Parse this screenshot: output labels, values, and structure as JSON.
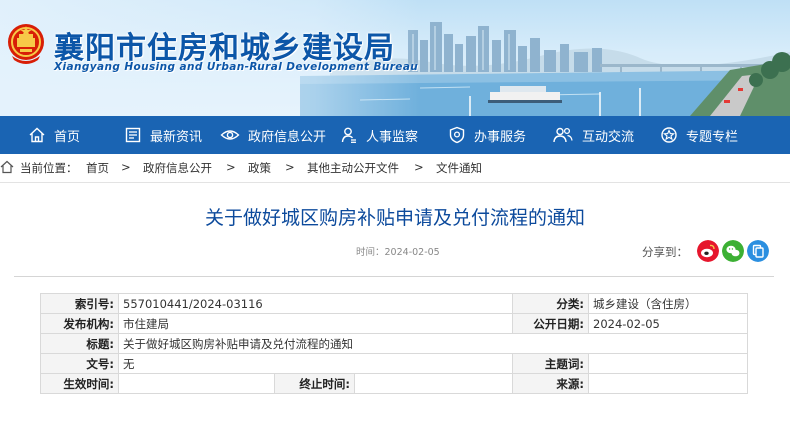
{
  "site": {
    "title": "襄阳市住房和城乡建设局",
    "subtitle": "Xiangyang Housing and Urban-Rural Development Bureau"
  },
  "nav": [
    {
      "label": "首页",
      "icon": "home-icon"
    },
    {
      "label": "最新资讯",
      "icon": "news-icon"
    },
    {
      "label": "政府信息公开",
      "icon": "eye-icon"
    },
    {
      "label": "人事监察",
      "icon": "person-icon"
    },
    {
      "label": "办事服务",
      "icon": "shield-icon"
    },
    {
      "label": "互动交流",
      "icon": "people-icon"
    },
    {
      "label": "专题专栏",
      "icon": "topic-icon"
    }
  ],
  "breadcrumb": {
    "label": "当前位置：",
    "separator": ">",
    "items": [
      "首页",
      "政府信息公开",
      "政策",
      "其他主动公开文件",
      "文件通知"
    ]
  },
  "article": {
    "title": "关于做好城区购房补贴申请及兑付流程的通知",
    "time_label": "时间：",
    "time": "2024-02-05",
    "share_label": "分享到："
  },
  "share_icons": [
    {
      "name": "weibo-icon",
      "color": "#e6162d"
    },
    {
      "name": "wechat-icon",
      "color": "#3cb034"
    },
    {
      "name": "qzone-icon",
      "color": "#2b8fe0"
    }
  ],
  "info": {
    "index_label": "索引号:",
    "index_value": "557010441/2024-03116",
    "category_label": "分类:",
    "category_value": "城乡建设（含住房）",
    "issuer_label": "发布机构:",
    "issuer_value": "市住建局",
    "publish_date_label": "公开日期:",
    "publish_date_value": "2024-02-05",
    "title_label": "标题:",
    "title_value": "关于做好城区购房补贴申请及兑付流程的通知",
    "doc_no_label": "文号:",
    "doc_no_value": "无",
    "subject_label": "主题词:",
    "subject_value": "",
    "effective_label": "生效时间:",
    "effective_value": "",
    "end_label": "终止时间:",
    "end_value": "",
    "source_label": "来源:",
    "source_value": ""
  },
  "colors": {
    "nav_bg": "#1a64b3",
    "title_blue": "#0c4a9c",
    "banner_text": "#0c56a8"
  }
}
